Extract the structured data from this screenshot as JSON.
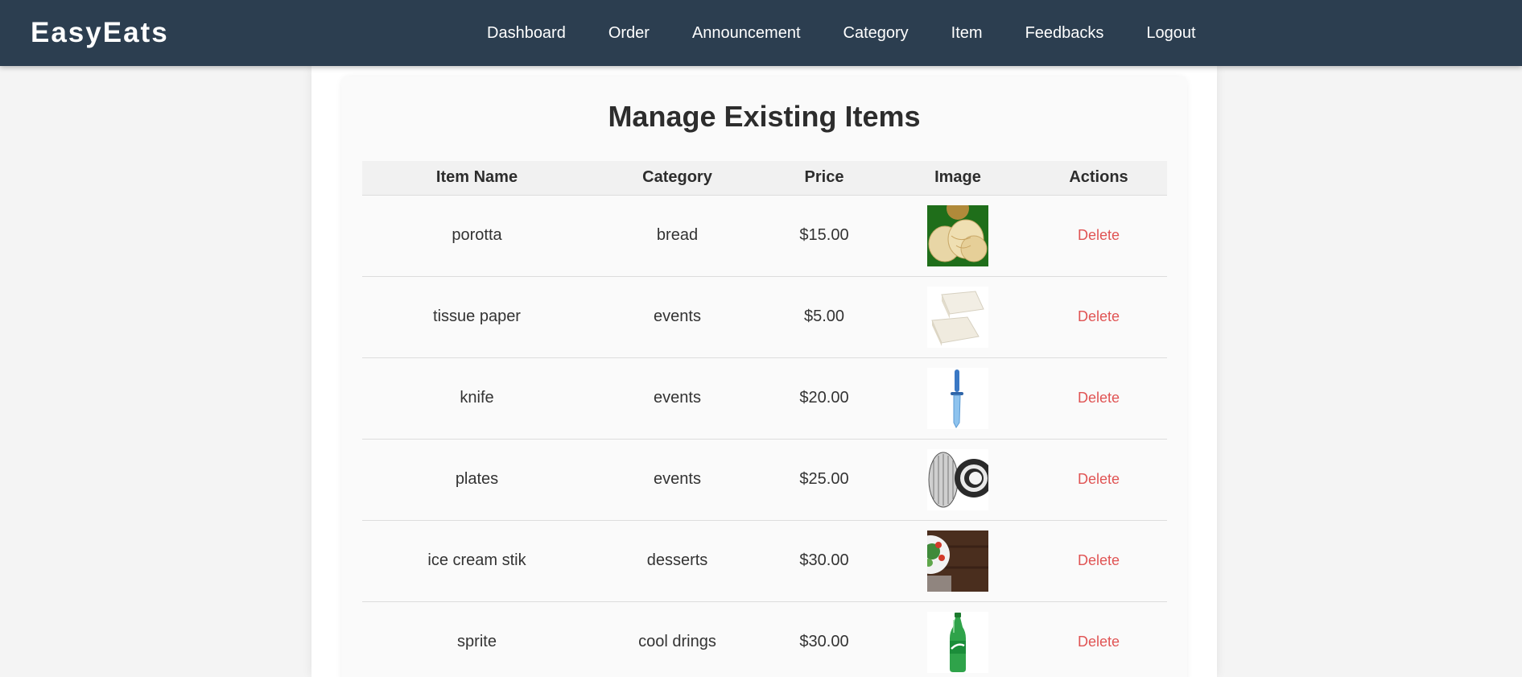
{
  "brand": "EasyEats",
  "nav": {
    "items": [
      {
        "label": "Dashboard"
      },
      {
        "label": "Order"
      },
      {
        "label": "Announcement"
      },
      {
        "label": "Category"
      },
      {
        "label": "Item"
      },
      {
        "label": "Feedbacks"
      },
      {
        "label": "Logout"
      }
    ]
  },
  "page": {
    "title": "Manage Existing Items"
  },
  "table": {
    "headers": [
      "Item Name",
      "Category",
      "Price",
      "Image",
      "Actions"
    ],
    "rows": [
      {
        "name": "porotta",
        "category": "bread",
        "price": "$15.00",
        "image": "porotta-image",
        "action": "Delete"
      },
      {
        "name": "tissue paper",
        "category": "events",
        "price": "$5.00",
        "image": "tissue-paper-image",
        "action": "Delete"
      },
      {
        "name": "knife",
        "category": "events",
        "price": "$20.00",
        "image": "knife-image",
        "action": "Delete"
      },
      {
        "name": "plates",
        "category": "events",
        "price": "$25.00",
        "image": "plates-image",
        "action": "Delete"
      },
      {
        "name": "ice cream stik",
        "category": "desserts",
        "price": "$30.00",
        "image": "salad-bowl-image",
        "action": "Delete"
      },
      {
        "name": "sprite",
        "category": "cool drings",
        "price": "$30.00",
        "image": "sprite-bottle-image",
        "action": "Delete"
      }
    ]
  },
  "colors": {
    "navbar": "#2c3e50",
    "delete": "#e05454",
    "background": "#f4f4f4"
  }
}
